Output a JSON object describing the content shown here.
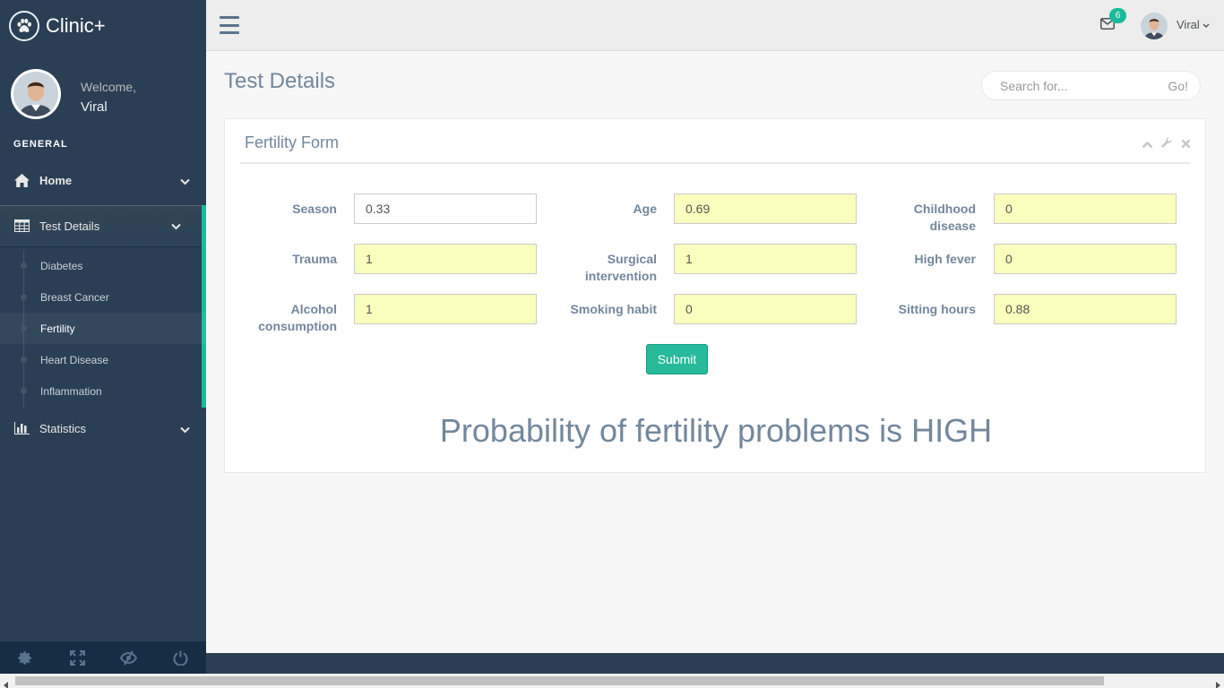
{
  "app": {
    "title": "Clinic+"
  },
  "profile": {
    "welcome": "Welcome,",
    "name": "Viral"
  },
  "sidebar": {
    "section": "GENERAL",
    "home": "Home",
    "test_details": "Test Details",
    "submenu": [
      "Diabetes",
      "Breast Cancer",
      "Fertility",
      "Heart Disease",
      "Inflammation"
    ],
    "active_submenu": "Fertility",
    "statistics": "Statistics"
  },
  "topnav": {
    "mail_count": "6",
    "user": "Viral"
  },
  "page": {
    "title": "Test Details"
  },
  "search": {
    "placeholder": "Search for...",
    "button": "Go!"
  },
  "form": {
    "title": "Fertility Form",
    "fields": {
      "season": {
        "label": "Season",
        "value": "0.33"
      },
      "age": {
        "label": "Age",
        "value": "0.69"
      },
      "childhood_disease": {
        "label_1": "Childhood",
        "label_2": "disease",
        "value": "0"
      },
      "trauma": {
        "label": "Trauma",
        "value": "1"
      },
      "surgical_intervention": {
        "label_1": "Surgical",
        "label_2": "intervention",
        "value": "1"
      },
      "high_fever": {
        "label": "High fever",
        "value": "0"
      },
      "alcohol_consumption": {
        "label_1": "Alcohol",
        "label_2": "consumption",
        "value": "1"
      },
      "smoking_habit": {
        "label": "Smoking habit",
        "value": "0"
      },
      "sitting_hours": {
        "label": "Sitting hours",
        "value": "0.88"
      }
    },
    "submit": "Submit",
    "result": "Probability of fertility problems is HIGH"
  },
  "colors": {
    "sidebar": "#2A3F54",
    "accent": "#1ABB9C",
    "autofill": "#FAFFBD",
    "submit": "#26B99A"
  },
  "icons": [
    "paw-icon",
    "home-icon",
    "table-icon",
    "bar-chart-icon",
    "chevron-down-icon",
    "envelope-icon",
    "gear-icon",
    "fullscreen-icon",
    "eye-slash-icon",
    "power-icon",
    "chevron-up-icon",
    "wrench-icon",
    "close-icon",
    "menu-icon"
  ]
}
